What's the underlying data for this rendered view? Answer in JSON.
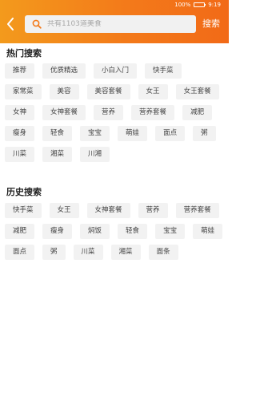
{
  "status_bar": {
    "info": "100%",
    "time": "9:19"
  },
  "header": {
    "search_placeholder": "共有1103道美食",
    "search_button": "搜索"
  },
  "hot": {
    "title": "热门搜索",
    "tags": [
      "推荐",
      "优质精选",
      "小白入门",
      "快手菜",
      "家常菜",
      "美容",
      "美容套餐",
      "女王",
      "女王套餐",
      "女神",
      "女神套餐",
      "营养",
      "营养套餐",
      "减肥",
      "瘦身",
      "轻食",
      "宝宝",
      "萌娃",
      "面点",
      "粥",
      "川菜",
      "湘菜",
      "川湘"
    ]
  },
  "history": {
    "title": "历史搜索",
    "tags": [
      "快手菜",
      "女王",
      "女神套餐",
      "营养",
      "营养套餐",
      "减肥",
      "瘦身",
      "焖饭",
      "轻食",
      "宝宝",
      "萌娃",
      "面点",
      "粥",
      "川菜",
      "湘菜",
      "面条"
    ]
  },
  "colors": {
    "accent": "#f37a1a",
    "tag_bg": "#f2f2f2"
  }
}
